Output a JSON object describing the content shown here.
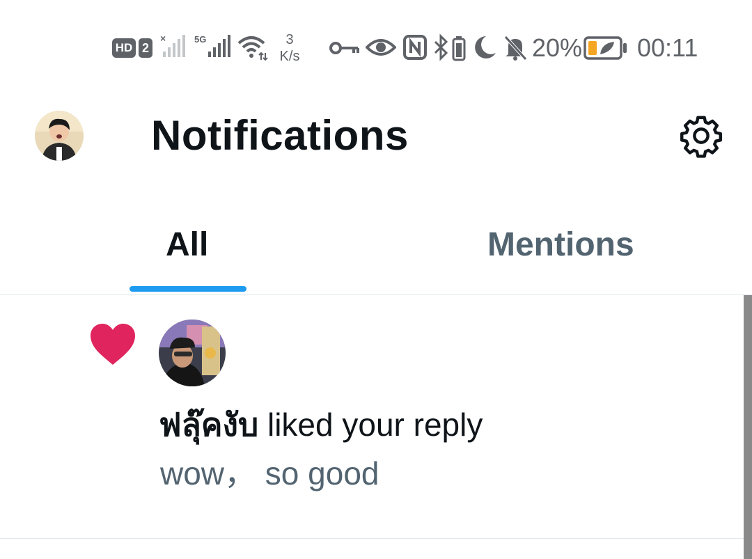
{
  "status_bar": {
    "hd_badge": "HD",
    "sim_badge": "2",
    "network_5g": "5G",
    "speed_value": "3",
    "speed_unit": "K/s",
    "battery_percent": "20%",
    "time": "00:11",
    "icons": [
      "hd-icon",
      "sim-icon",
      "no-signal-icon",
      "signal-5g-icon",
      "wifi-icon",
      "vpn-key-icon",
      "eye-icon",
      "nfc-icon",
      "bluetooth-icon",
      "battery-small-icon",
      "moon-icon",
      "bell-off-icon",
      "battery-icon"
    ],
    "colors": {
      "icon": "#5f6368",
      "battery_fill": "#f5a623"
    }
  },
  "header": {
    "title": "Notifications",
    "avatar": "profile-avatar",
    "settings_icon": "gear-icon"
  },
  "tabs": [
    {
      "label": "All",
      "active": true
    },
    {
      "label": "Mentions",
      "active": false
    }
  ],
  "notifications": [
    {
      "type": "like",
      "icon": "heart-icon",
      "user": "ฟลุ๊คงับ",
      "action": " liked your reply",
      "reply": "wow，  so good"
    }
  ],
  "colors": {
    "accent": "#1d9bf0",
    "like": "#e0245e",
    "primary_text": "#0f1419",
    "secondary_text": "#536471",
    "divider": "#e1e8ed"
  }
}
